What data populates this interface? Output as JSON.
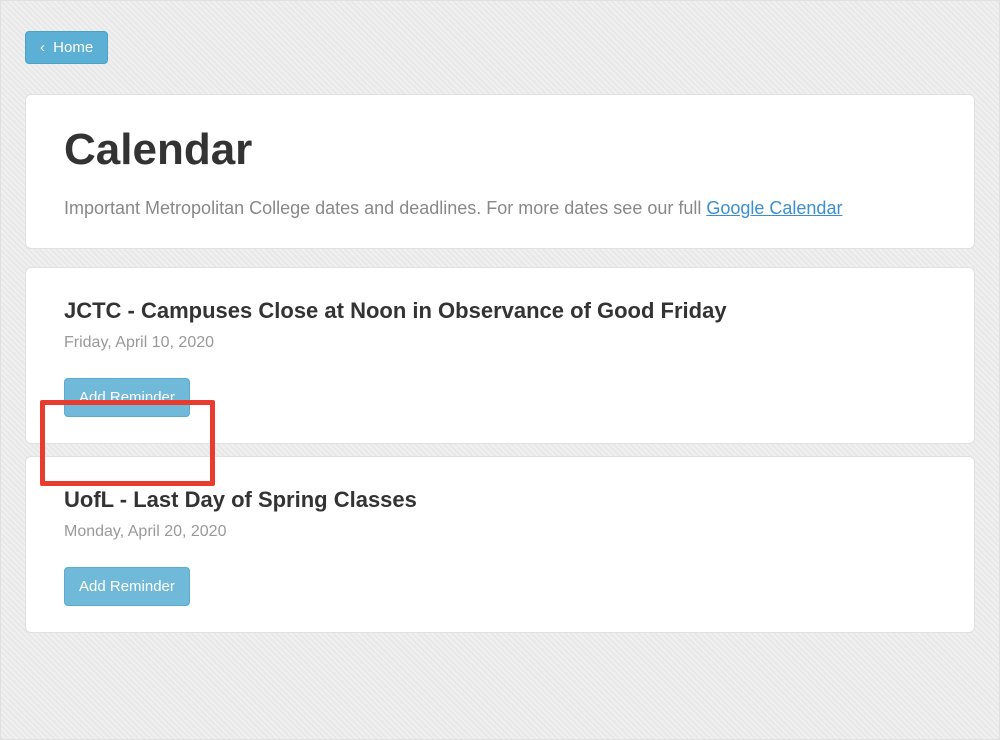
{
  "nav": {
    "home_label": "Home",
    "chevron": "‹"
  },
  "header": {
    "title": "Calendar",
    "subtitle_prefix": "Important Metropolitan College dates and deadlines. For more dates see our full ",
    "subtitle_link_text": "Google Calendar"
  },
  "events": [
    {
      "title": "JCTC - Campuses Close at Noon in Observance of Good Friday",
      "date": "Friday, April 10, 2020",
      "button_label": "Add Reminder",
      "highlighted": true
    },
    {
      "title": "UofL - Last Day of Spring Classes",
      "date": "Monday, April 20, 2020",
      "button_label": "Add Reminder",
      "highlighted": false
    }
  ],
  "colors": {
    "accent": "#6bb8d8",
    "highlight": "#e83c2e"
  }
}
